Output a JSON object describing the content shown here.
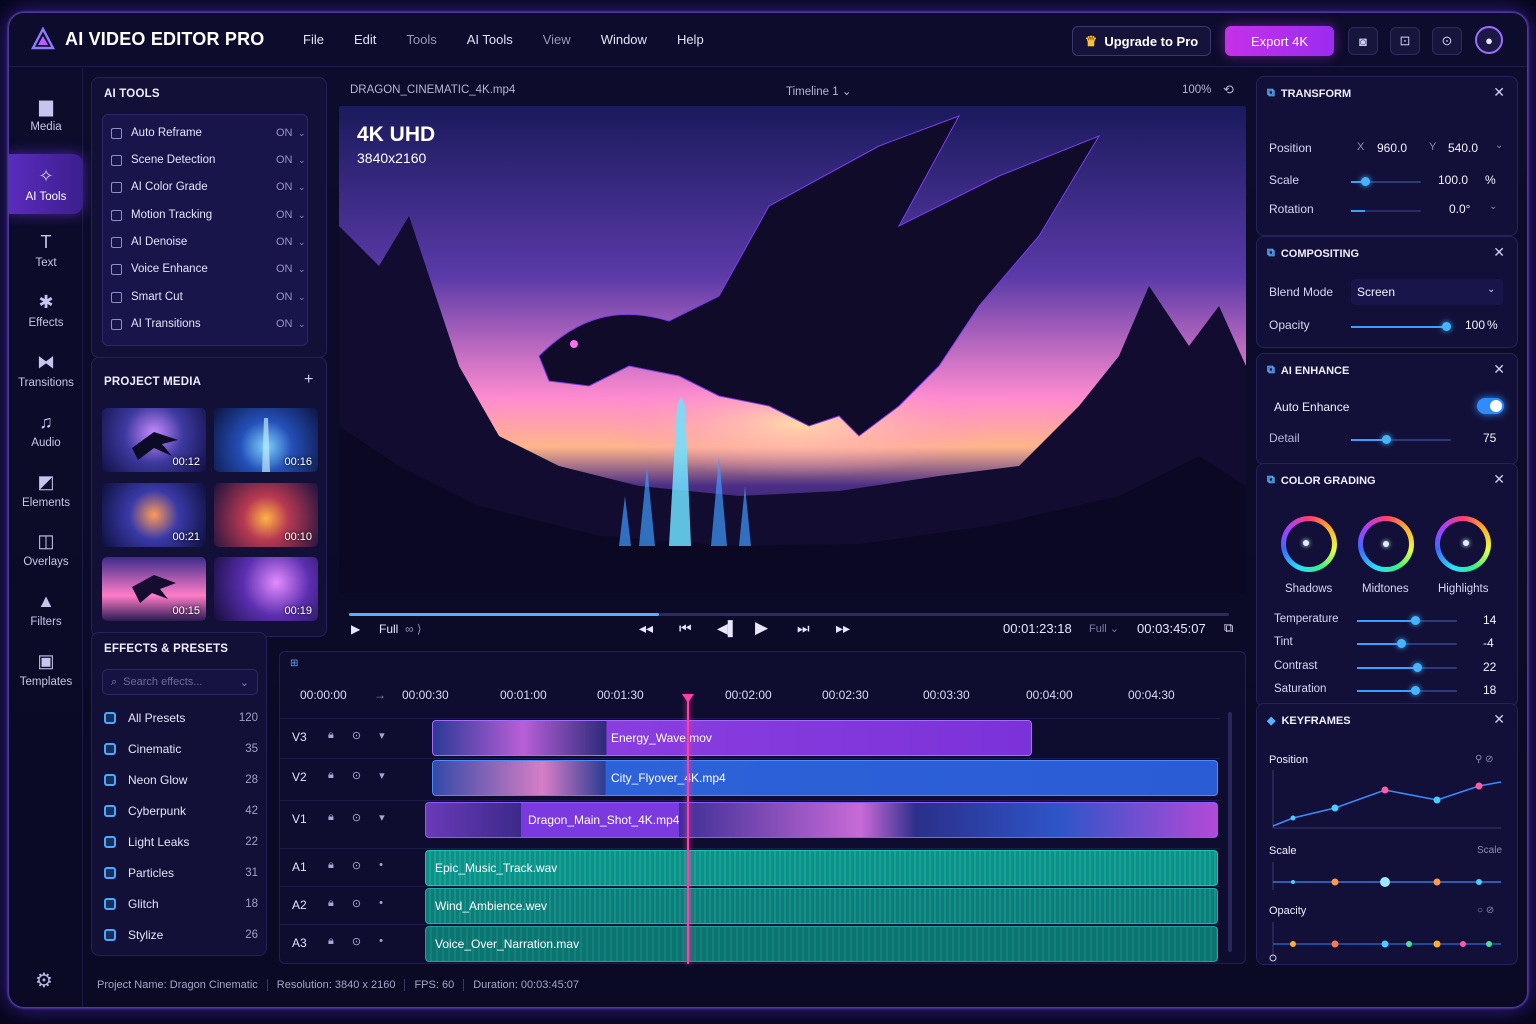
{
  "app": {
    "title": "AI VIDEO EDITOR PRO"
  },
  "menu": [
    "File",
    "Edit",
    "Tools",
    "AI Tools",
    "View",
    "Window",
    "Help"
  ],
  "header": {
    "upgrade_label": "Upgrade to Pro",
    "export_label": "Export 4K"
  },
  "sidebar": {
    "items": [
      {
        "label": "Media",
        "icon": "folder-icon"
      },
      {
        "label": "AI Tools",
        "icon": "sparkle-icon"
      },
      {
        "label": "Text",
        "icon": "text-icon"
      },
      {
        "label": "Effects",
        "icon": "effects-icon"
      },
      {
        "label": "Transitions",
        "icon": "transitions-icon"
      },
      {
        "label": "Audio",
        "icon": "music-note-icon"
      },
      {
        "label": "Elements",
        "icon": "elements-icon"
      },
      {
        "label": "Overlays",
        "icon": "overlays-icon"
      },
      {
        "label": "Filters",
        "icon": "filters-icon"
      },
      {
        "label": "Templates",
        "icon": "templates-icon"
      }
    ],
    "active": "AI Tools"
  },
  "ai_tools": {
    "title": "AI TOOLS",
    "items": [
      {
        "label": "Auto Reframe",
        "state": "ON"
      },
      {
        "label": "Scene Detection",
        "state": "ON"
      },
      {
        "label": "AI Color Grade",
        "state": "ON"
      },
      {
        "label": "Motion Tracking",
        "state": "ON"
      },
      {
        "label": "AI Denoise",
        "state": "ON"
      },
      {
        "label": "Voice Enhance",
        "state": "ON"
      },
      {
        "label": "Smart Cut",
        "state": "ON"
      },
      {
        "label": "AI Transitions",
        "state": "ON"
      }
    ]
  },
  "project_media": {
    "title": "PROJECT MEDIA",
    "add": "+",
    "items": [
      {
        "duration": "00:12"
      },
      {
        "duration": "00:16"
      },
      {
        "duration": "00:21"
      },
      {
        "duration": "00:10"
      },
      {
        "duration": "00:15"
      },
      {
        "duration": "00:19"
      }
    ]
  },
  "effects": {
    "title": "EFFECTS & PRESETS",
    "search_placeholder": "Search effects...",
    "items": [
      {
        "label": "All Presets",
        "count": "120"
      },
      {
        "label": "Cinematic",
        "count": "35"
      },
      {
        "label": "Neon Glow",
        "count": "28"
      },
      {
        "label": "Cyberpunk",
        "count": "42"
      },
      {
        "label": "Light Leaks",
        "count": "22"
      },
      {
        "label": "Particles",
        "count": "31"
      },
      {
        "label": "Glitch",
        "count": "18"
      },
      {
        "label": "Stylize",
        "count": "26"
      }
    ]
  },
  "viewer": {
    "filename": "DRAGON_CINEMATIC_4K.mp4",
    "timeline_name": "Timeline 1",
    "zoom": "100%",
    "overlay_title": "4K UHD",
    "overlay_res": "3840x2160",
    "quality": "Full",
    "quality2": "Full",
    "current_time": "00:01:23:18",
    "total_time": "00:03:45:07",
    "progress": 0.44
  },
  "timeline": {
    "ruler": [
      "00:00:00",
      "00:00:30",
      "00:01:00",
      "00:01:30",
      "00:02:00",
      "00:02:30",
      "00:03:30",
      "00:04:00",
      "00:04:30"
    ],
    "tracks": [
      {
        "label": "V3",
        "clip": "Energy_Wave.mov"
      },
      {
        "label": "V2",
        "clip": "City_Flyover_4K.mp4"
      },
      {
        "label": "V1",
        "clip": "Dragon_Main_Shot_4K.mp4"
      },
      {
        "label": "A1",
        "clip": "Epic_Music_Track.wav"
      },
      {
        "label": "A2",
        "clip": "Wind_Ambience.wev"
      },
      {
        "label": "A3",
        "clip": "Voice_Over_Narration.mav"
      }
    ]
  },
  "transform": {
    "title": "TRANSFORM",
    "position_label": "Position",
    "x_label": "X",
    "x": "960.0",
    "y_label": "Y",
    "y": "540.0",
    "scale_label": "Scale",
    "scale": "100.0",
    "scale_unit": "%",
    "scale_level": 0.2,
    "rotation_label": "Rotation",
    "rotation": "0.0°"
  },
  "compositing": {
    "title": "COMPOSITING",
    "blend_label": "Blend Mode",
    "blend": "Screen",
    "opacity_label": "Opacity",
    "opacity": "100",
    "opacity_unit": "%",
    "opacity_level": 1.0
  },
  "ai_enhance": {
    "title": "AI ENHANCE",
    "toggle_label": "Auto Enhance",
    "toggle_on": true,
    "detail_label": "Detail",
    "detail": "75",
    "detail_level": 0.35
  },
  "color_grading": {
    "title": "COLOR GRADING",
    "wheels": [
      "Shadows",
      "Midtones",
      "Highlights"
    ],
    "sliders": [
      {
        "label": "Temperature",
        "value": "14",
        "level": 0.58
      },
      {
        "label": "Tint",
        "value": "-4",
        "level": 0.44
      },
      {
        "label": "Contrast",
        "value": "22",
        "level": 0.62
      },
      {
        "label": "Saturation",
        "value": "18",
        "level": 0.6
      }
    ]
  },
  "keyframes": {
    "title": "KEYFRAMES",
    "rows": [
      "Position",
      "Scale",
      "Opacity"
    ],
    "scale_right": "Scale"
  },
  "status": {
    "project": "Project Name: Dragon Cinematic",
    "resolution": "Resolution: 3840 x 2160",
    "fps": "FPS: 60",
    "duration": "Duration: 00:03:45:07"
  },
  "colors": {
    "accent": "#9b2cf0",
    "blue": "#3aa0ff",
    "playhead": "#ff3fa8",
    "audio": "#0f8f86"
  }
}
